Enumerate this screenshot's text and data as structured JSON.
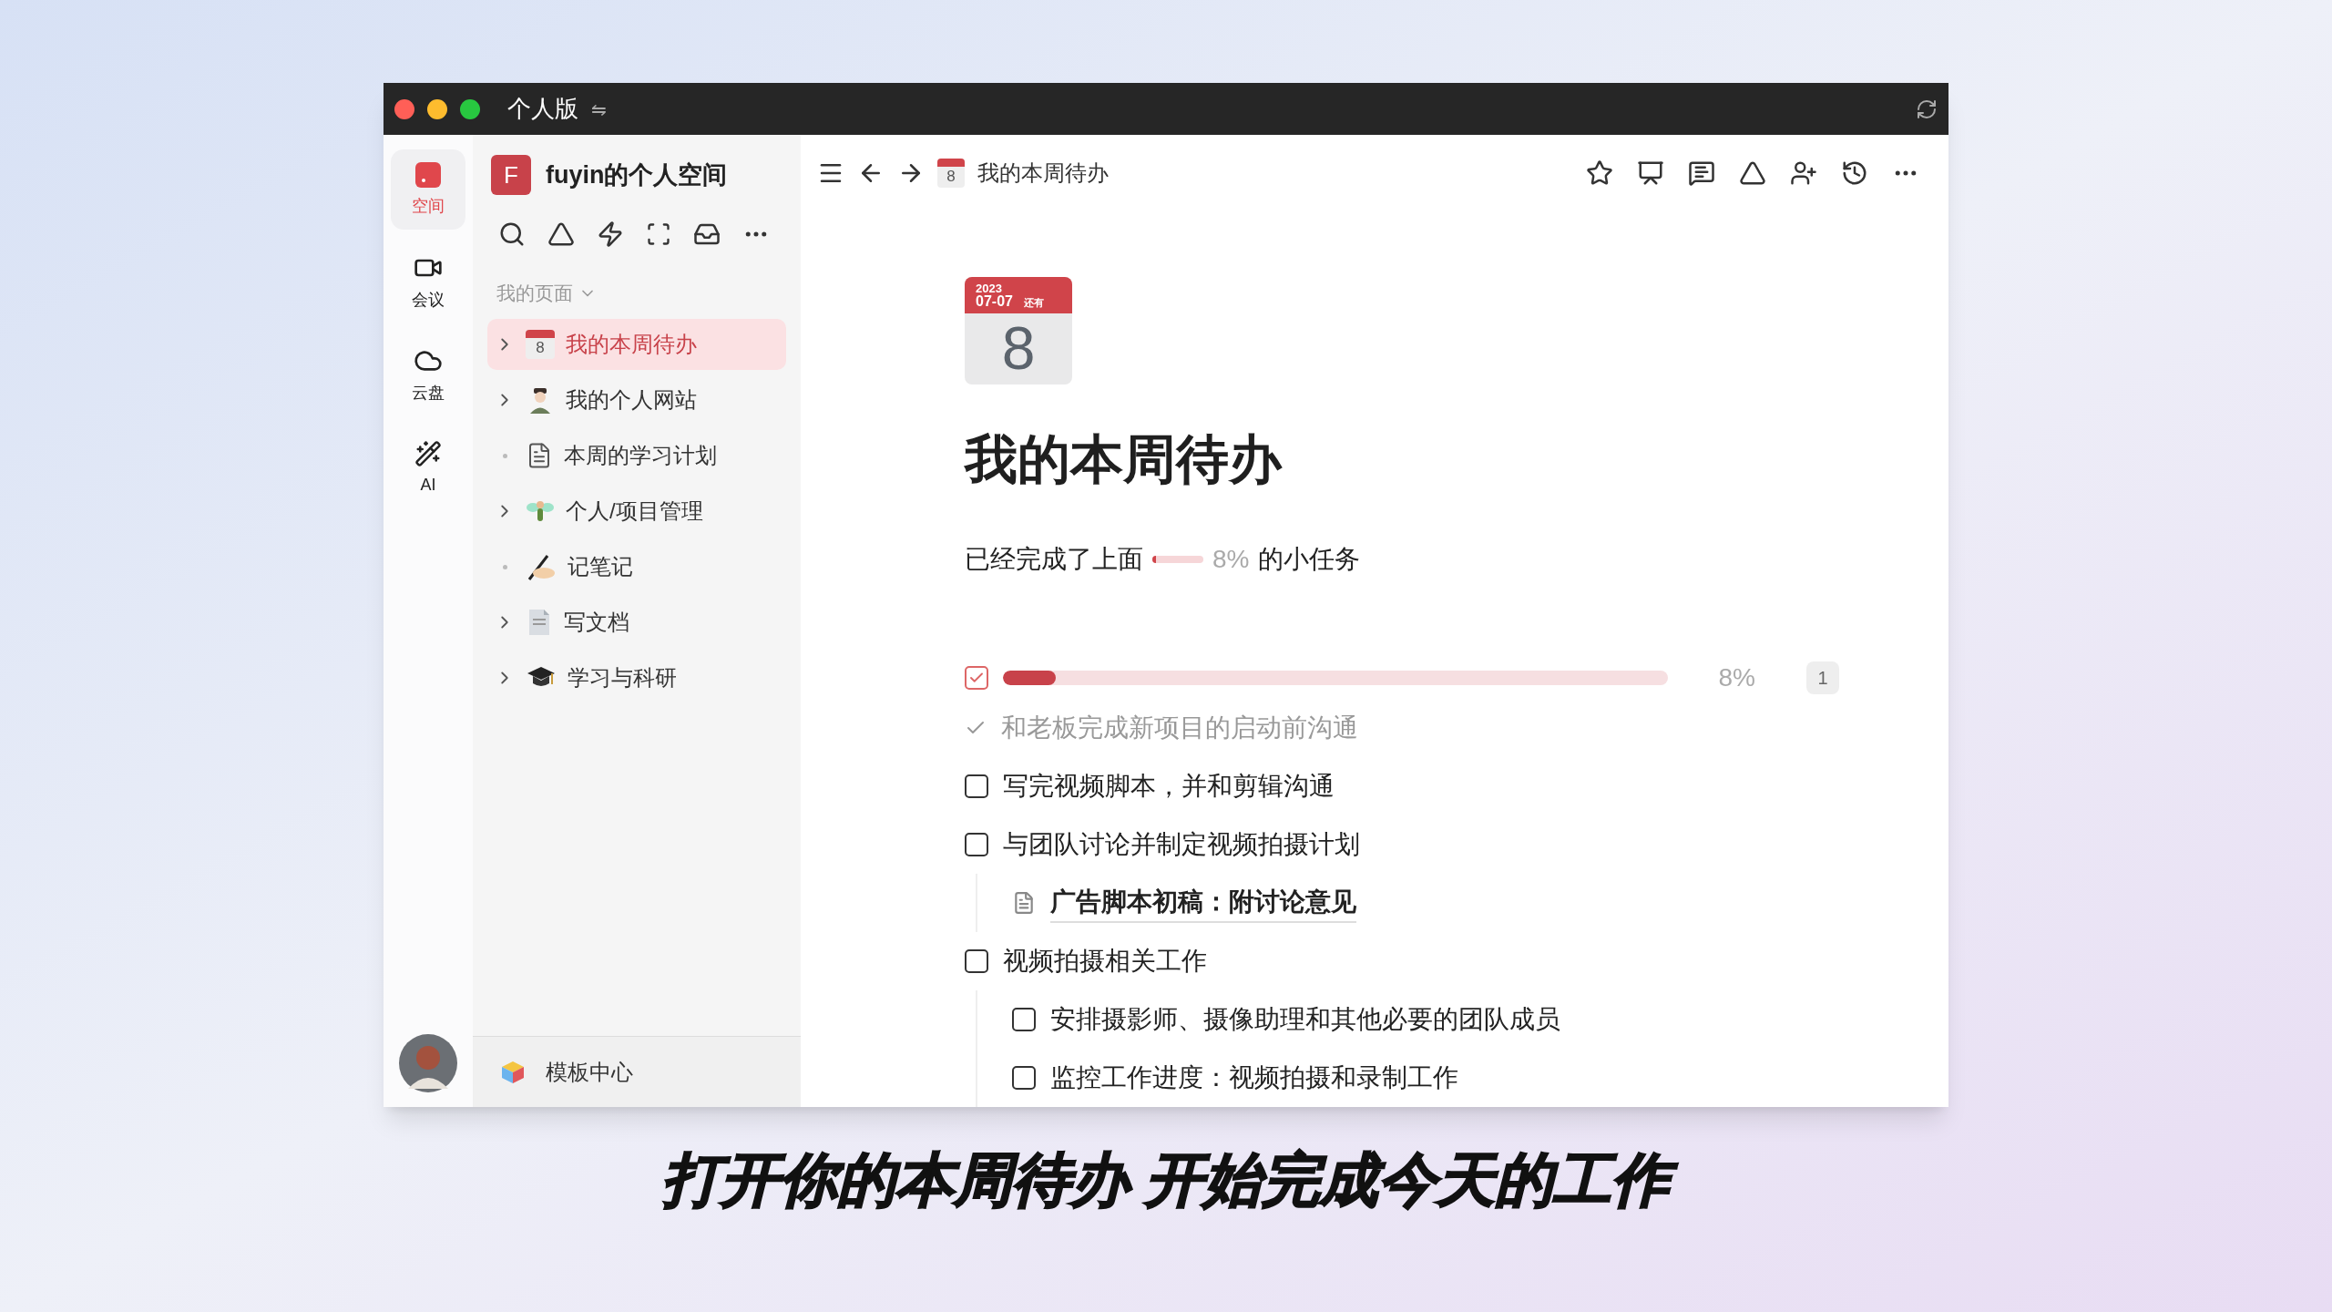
{
  "window": {
    "title": "个人版",
    "switch_glyph": "⇋"
  },
  "rail": [
    {
      "label": "空间",
      "selected": true,
      "kind": "space"
    },
    {
      "label": "会议",
      "selected": false,
      "kind": "video"
    },
    {
      "label": "云盘",
      "selected": false,
      "kind": "cloud"
    },
    {
      "label": "AI",
      "selected": false,
      "kind": "ai"
    }
  ],
  "sidebar": {
    "logo_letter": "F",
    "space_name": "fuyin的个人空间",
    "section": "我的页面",
    "items": [
      {
        "label": "我的本周待办",
        "selected": true,
        "kind": "folder",
        "icon_text": "8"
      },
      {
        "label": "我的个人网站",
        "selected": false,
        "kind": "folder"
      },
      {
        "label": "本周的学习计划",
        "selected": false,
        "kind": "page"
      },
      {
        "label": "个人/项目管理",
        "selected": false,
        "kind": "folder"
      },
      {
        "label": "记笔记",
        "selected": false,
        "kind": "page"
      },
      {
        "label": "写文档",
        "selected": false,
        "kind": "folder"
      },
      {
        "label": "学习与科研",
        "selected": false,
        "kind": "folder"
      }
    ],
    "footer": "模板中心"
  },
  "header": {
    "page_icon_text": "8",
    "page_title": "我的本周待办"
  },
  "cover": {
    "year": "2023",
    "date": "07-07",
    "note": "还有",
    "day": "8"
  },
  "title": "我的本周待办",
  "summary": {
    "before": "已经完成了上面",
    "level": 0.08,
    "percent": "8%",
    "after": "的小任务"
  },
  "task_progress": {
    "checked": true,
    "level": 0.08,
    "percent": "8%",
    "count": "1"
  },
  "tasks": [
    {
      "kind": "todo",
      "text": "和老板完成新项目的启动前沟通",
      "checked": true
    },
    {
      "kind": "todo",
      "text": "写完视频脚本，并和剪辑沟通",
      "checked": false
    },
    {
      "kind": "todo",
      "text": "与团队讨论并制定视频拍摄计划",
      "checked": false,
      "children": [
        {
          "kind": "doc",
          "text": "广告脚本初稿：附讨论意见"
        }
      ]
    },
    {
      "kind": "todo",
      "text": "视频拍摄相关工作",
      "checked": false,
      "children": [
        {
          "kind": "todo",
          "text": "安排摄影师、摄像助理和其他必要的团队成员",
          "checked": false
        },
        {
          "kind": "todo",
          "text": "监控工作进度：视频拍摄和录制工作",
          "checked": false
        }
      ]
    }
  ],
  "caption": "打开你的本周待办 开始完成今天的工作"
}
